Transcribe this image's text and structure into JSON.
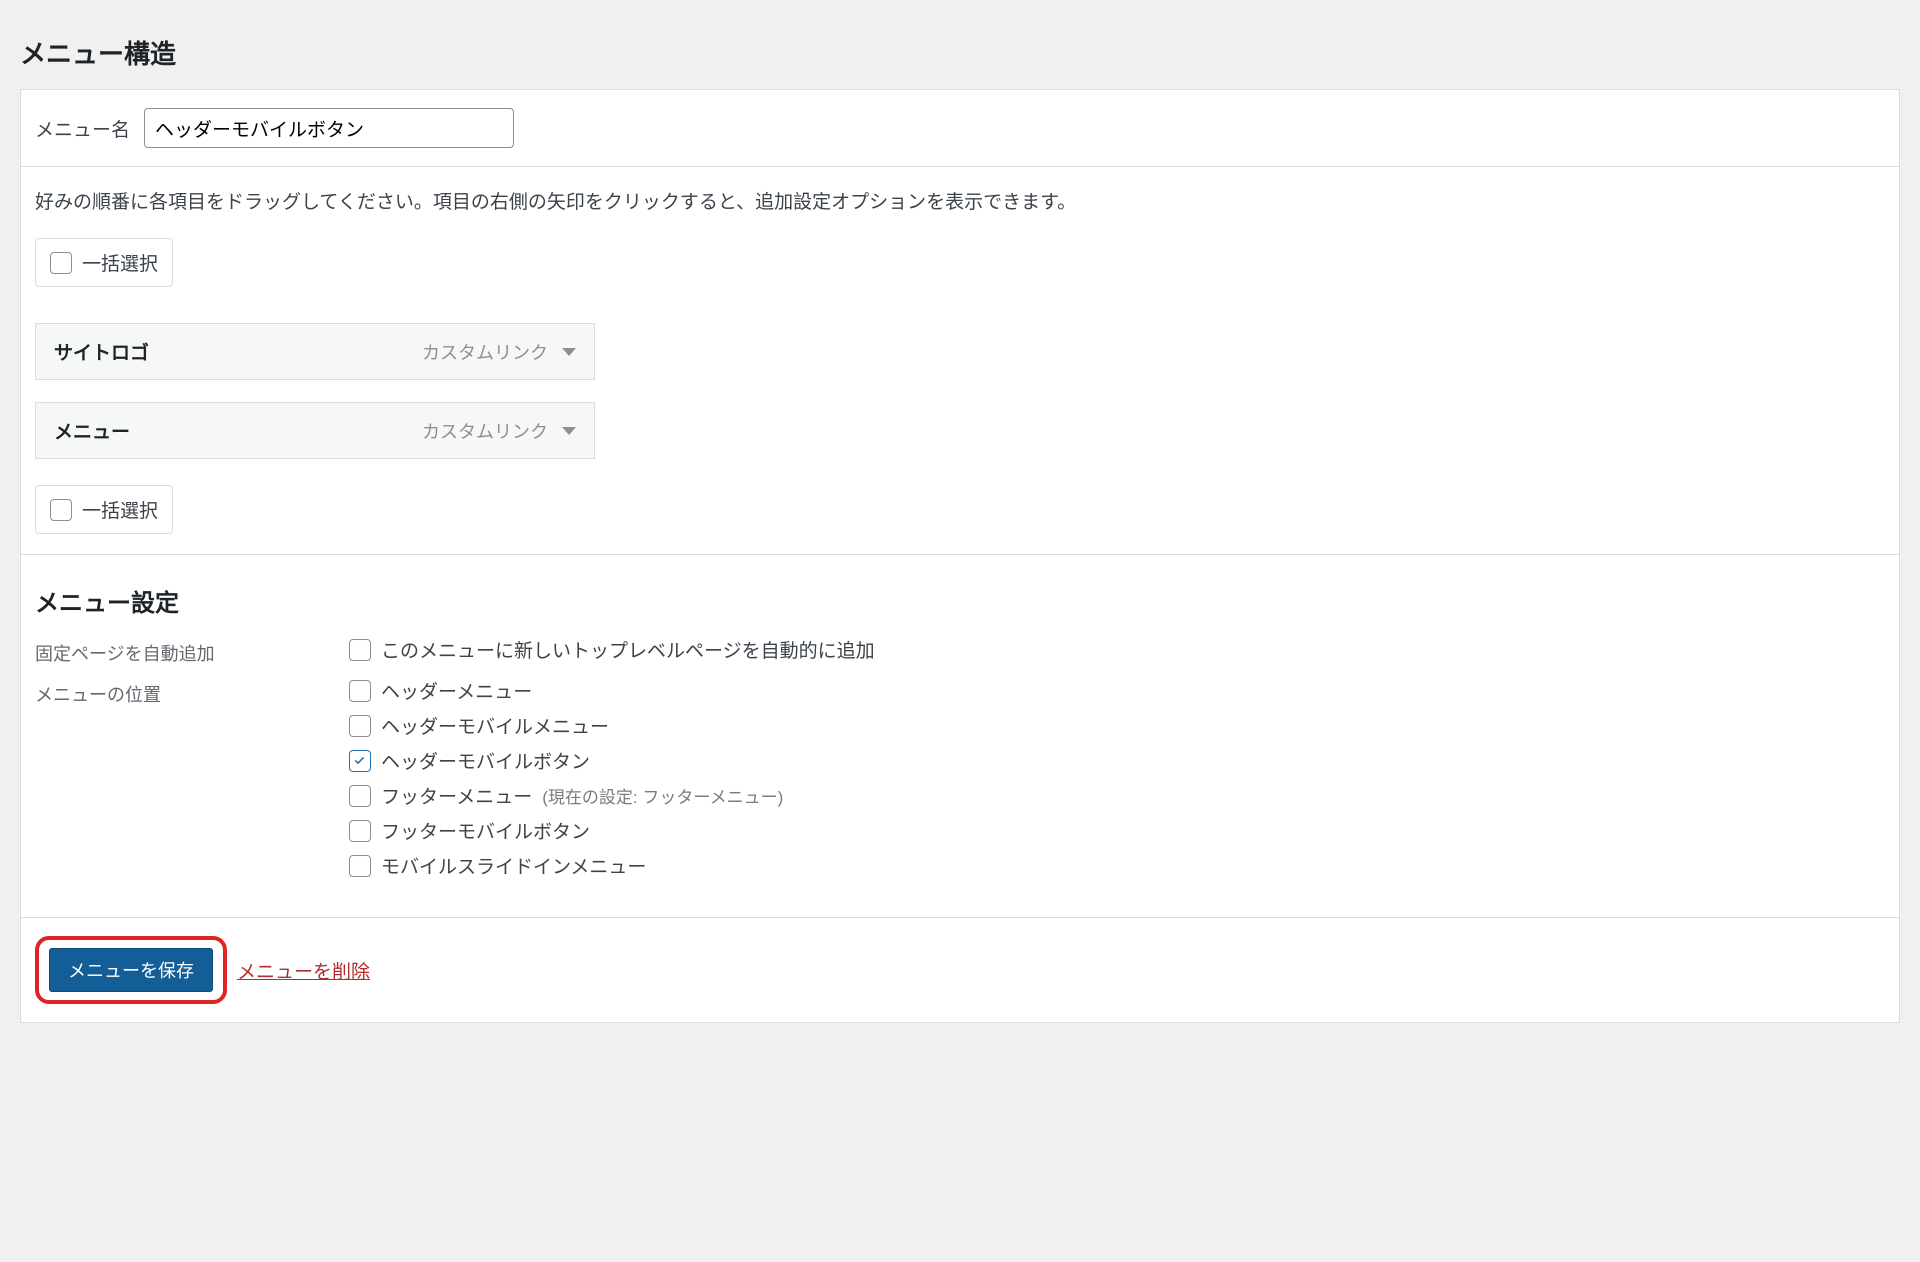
{
  "structure": {
    "heading": "メニュー構造",
    "menu_name_label": "メニュー名",
    "menu_name_value": "ヘッダーモバイルボタン",
    "instructions": "好みの順番に各項目をドラッグしてください。項目の右側の矢印をクリックすると、追加設定オプションを表示できます。",
    "bulk_select_label": "一括選択",
    "items": [
      {
        "title": "サイトロゴ",
        "type": "カスタムリンク"
      },
      {
        "title": "メニュー",
        "type": "カスタムリンク"
      }
    ]
  },
  "settings": {
    "heading": "メニュー設定",
    "auto_add": {
      "label": "固定ページを自動追加",
      "option": "このメニューに新しいトップレベルページを自動的に追加",
      "checked": false
    },
    "locations": {
      "label": "メニューの位置",
      "options": [
        {
          "label": "ヘッダーメニュー",
          "checked": false,
          "sub": ""
        },
        {
          "label": "ヘッダーモバイルメニュー",
          "checked": false,
          "sub": ""
        },
        {
          "label": "ヘッダーモバイルボタン",
          "checked": true,
          "sub": ""
        },
        {
          "label": "フッターメニュー",
          "checked": false,
          "sub": "(現在の設定: フッターメニュー)"
        },
        {
          "label": "フッターモバイルボタン",
          "checked": false,
          "sub": ""
        },
        {
          "label": "モバイルスライドインメニュー",
          "checked": false,
          "sub": ""
        }
      ]
    }
  },
  "footer": {
    "save_label": "メニューを保存",
    "delete_label": "メニューを削除"
  }
}
